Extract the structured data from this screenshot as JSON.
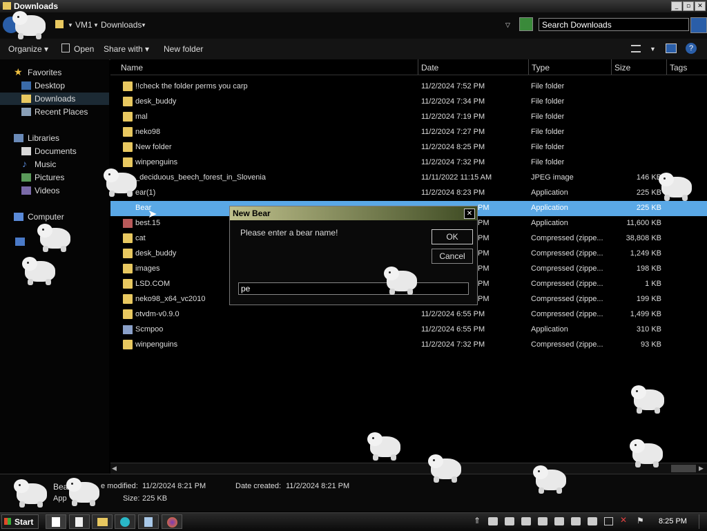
{
  "window": {
    "title": "Downloads"
  },
  "address": {
    "crumbs": [
      "VM1",
      "Downloads"
    ],
    "search_placeholder": "Search Downloads"
  },
  "toolbar": {
    "organize": "Organize",
    "open": "Open",
    "share_with": "Share with",
    "new_folder": "New folder"
  },
  "nav": {
    "favorites": "Favorites",
    "fav_items": [
      "Desktop",
      "Downloads",
      "Recent Places"
    ],
    "libraries": "Libraries",
    "lib_items": [
      "Documents",
      "Music",
      "Pictures",
      "Videos"
    ],
    "computer": "Computer"
  },
  "columns": {
    "name": "Name",
    "date": "Date",
    "type": "Type",
    "size": "Size",
    "tags": "Tags"
  },
  "files": [
    {
      "name": "!!check the folder perms you carp",
      "date": "11/2/2024 7:52 PM",
      "type": "File folder",
      "size": ""
    },
    {
      "name": "desk_buddy",
      "date": "11/2/2024 7:34 PM",
      "type": "File folder",
      "size": ""
    },
    {
      "name": "mal",
      "date": "11/2/2024 7:19 PM",
      "type": "File folder",
      "size": ""
    },
    {
      "name": "neko98",
      "date": "11/2/2024 7:27 PM",
      "type": "File folder",
      "size": ""
    },
    {
      "name": "New folder",
      "date": "11/2/2024 8:25 PM",
      "type": "File folder",
      "size": ""
    },
    {
      "name": "winpenguins",
      "date": "11/2/2024 7:32 PM",
      "type": "File folder",
      "size": ""
    },
    {
      "name": "_deciduous_beech_forest_in_Slovenia",
      "date": "11/11/2022 11:15 AM",
      "type": "JPEG image",
      "size": "146 KB"
    },
    {
      "name": "ear(1)",
      "date": "11/2/2024 8:23 PM",
      "type": "Application",
      "size": "225 KB"
    },
    {
      "name": "Bear",
      "date": "PM",
      "type": "Application",
      "size": "225 KB"
    },
    {
      "name": "best.15",
      "date": "PM",
      "type": "Application",
      "size": "11,600 KB"
    },
    {
      "name": "cat",
      "date": "PM",
      "type": "Compressed (zippe...",
      "size": "38,808 KB"
    },
    {
      "name": "desk_buddy",
      "date": "PM",
      "type": "Compressed (zippe...",
      "size": "1,249 KB"
    },
    {
      "name": "images",
      "date": "PM",
      "type": "Compressed (zippe...",
      "size": "198 KB"
    },
    {
      "name": "LSD.COM",
      "date": "PM",
      "type": "Compressed (zippe...",
      "size": "1 KB"
    },
    {
      "name": "neko98_x64_vc2010",
      "date": "PM",
      "type": "Compressed (zippe...",
      "size": "199 KB"
    },
    {
      "name": "otvdm-v0.9.0",
      "date": "11/2/2024 6:55 PM",
      "type": "Compressed (zippe...",
      "size": "1,499 KB"
    },
    {
      "name": "Scmpoo",
      "date": "11/2/2024 6:55 PM",
      "type": "Application",
      "size": "310 KB"
    },
    {
      "name": "winpenguins",
      "date": "11/2/2024 7:32 PM",
      "type": "Compressed (zippe...",
      "size": "93 KB"
    }
  ],
  "details": {
    "name": "Bea",
    "type": "App",
    "modified_label": "e modified:",
    "modified_value": "11/2/2024 8:21 PM",
    "created_label": "Date created:",
    "created_value": "11/2/2024 8:21 PM",
    "size_label": "Size:",
    "size_value": "225 KB"
  },
  "dialog": {
    "title": "New Bear",
    "prompt": "Please enter a bear name!",
    "ok": "OK",
    "cancel": "Cancel",
    "input_value": "pe"
  },
  "taskbar": {
    "start": "Start",
    "clock": "8:25 PM"
  },
  "colors": {
    "selection": "#5aa8e6",
    "dialog_title_start": "#bfc08c",
    "dialog_title_end": "#3d4a22"
  }
}
